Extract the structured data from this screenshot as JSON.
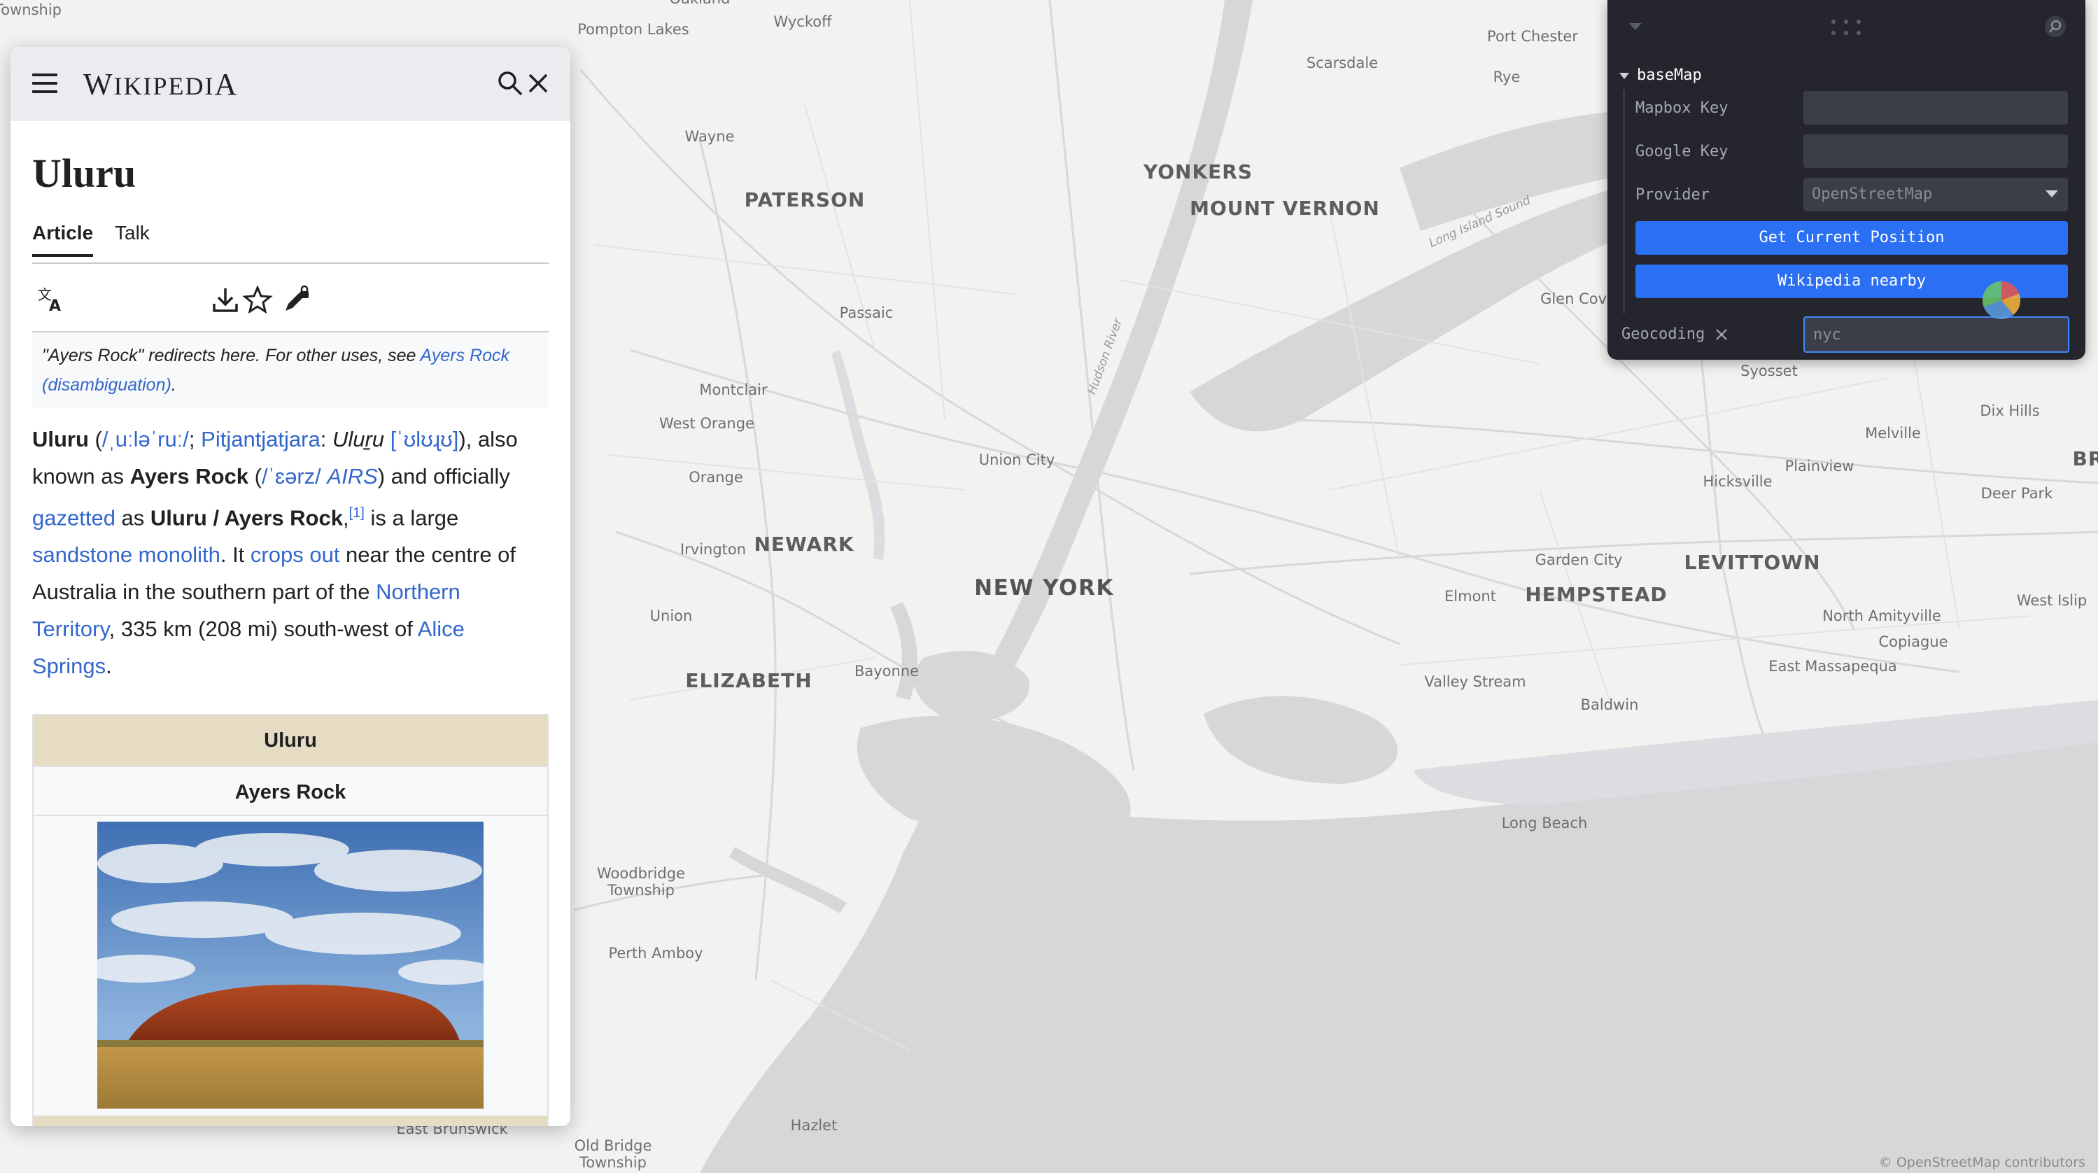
{
  "map": {
    "places": [
      {
        "name": "Township",
        "cls": ""
      },
      {
        "name": "Pompton Lakes",
        "cls": ""
      },
      {
        "name": "Oakland",
        "cls": ""
      },
      {
        "name": "Wyckoff",
        "cls": ""
      },
      {
        "name": "Port Chester",
        "cls": ""
      },
      {
        "name": "Scarsdale",
        "cls": ""
      },
      {
        "name": "Rye",
        "cls": ""
      },
      {
        "name": "Wayne",
        "cls": ""
      },
      {
        "name": "YONKERS",
        "cls": "city"
      },
      {
        "name": "PATERSON",
        "cls": "city"
      },
      {
        "name": "MOUNT VERNON",
        "cls": "city"
      },
      {
        "name": "Long Island Sound",
        "cls": "tilt"
      },
      {
        "name": "Glen Cove",
        "cls": ""
      },
      {
        "name": "Passaic",
        "cls": ""
      },
      {
        "name": "Hudson River",
        "cls": "tilt"
      },
      {
        "name": "Syosset",
        "cls": ""
      },
      {
        "name": "Montclair",
        "cls": ""
      },
      {
        "name": "West Orange",
        "cls": ""
      },
      {
        "name": "Dix Hills",
        "cls": ""
      },
      {
        "name": "Melville",
        "cls": ""
      },
      {
        "name": "Union City",
        "cls": ""
      },
      {
        "name": "Plainview",
        "cls": ""
      },
      {
        "name": "Orange",
        "cls": ""
      },
      {
        "name": "Hicksville",
        "cls": ""
      },
      {
        "name": "Deer Park",
        "cls": ""
      },
      {
        "name": "Irvington",
        "cls": ""
      },
      {
        "name": "NEWARK",
        "cls": "city"
      },
      {
        "name": "Garden City",
        "cls": ""
      },
      {
        "name": "LEVITTOWN",
        "cls": "city"
      },
      {
        "name": "NEW YORK",
        "cls": "big"
      },
      {
        "name": "Elmont",
        "cls": ""
      },
      {
        "name": "HEMPSTEAD",
        "cls": "city"
      },
      {
        "name": "West Islip",
        "cls": ""
      },
      {
        "name": "Union",
        "cls": ""
      },
      {
        "name": "North Amityville",
        "cls": ""
      },
      {
        "name": "Copiague",
        "cls": ""
      },
      {
        "name": "East Massapequa",
        "cls": ""
      },
      {
        "name": "Bayonne",
        "cls": ""
      },
      {
        "name": "ELIZABETH",
        "cls": "city"
      },
      {
        "name": "Valley Stream",
        "cls": ""
      },
      {
        "name": "Baldwin",
        "cls": ""
      },
      {
        "name": "Long Beach",
        "cls": ""
      },
      {
        "name": "Woodbridge\nTownship",
        "cls": ""
      },
      {
        "name": "Perth Amboy",
        "cls": ""
      },
      {
        "name": "East Brunswick",
        "cls": ""
      },
      {
        "name": "Hazlet",
        "cls": ""
      },
      {
        "name": "Old Bridge\nTownship",
        "cls": ""
      },
      {
        "name": "BR",
        "cls": "city"
      }
    ],
    "attribution": "© OpenStreetMap contributors"
  },
  "wiki": {
    "wordmark_first": "W",
    "wordmark_rest": "IKIPEDI",
    "wordmark_last": "A",
    "title": "Uluru",
    "tabs": [
      "Article",
      "Talk"
    ],
    "hatnote": {
      "text": "\"Ayers Rock\" redirects here. For other uses, see ",
      "link": "Ayers Rock (disambiguation)",
      "end": "."
    },
    "lead": {
      "b1": "Uluru",
      "t1": " (",
      "ipa1": "/ˌuːləˈruː/",
      "t2": "; ",
      "lang": "Pitjantjatjara",
      "t3": ": ",
      "i1": "Uluṟu",
      "t4": " ",
      "ipa2": "[ˈʊlʊɻʊ]",
      "t5": "), also known as ",
      "b2": "Ayers Rock",
      "t6": " (",
      "ipa3": "/ˈɛərz/",
      "t7": " ",
      "airs": "AIRS",
      "t8": ") and officially ",
      "l1": "gazetted",
      "t9": " as ",
      "b3": "Uluru / Ayers Rock",
      "t10": ",",
      "sup": "[1]",
      "t11": " is a large ",
      "l2": "sandstone monolith",
      "t12": ". It ",
      "l3": "crops out",
      "t13": " near the centre of Australia in the southern part of the ",
      "l4": "Northern Territory",
      "t14": ", 335 km (208 mi) south-west of ",
      "l5": "Alice Springs",
      "t15": "."
    },
    "infobox": {
      "title": "Uluru",
      "subtitle": "Ayers Rock"
    }
  },
  "gui": {
    "folder": "baseMap",
    "mapbox_label": "Mapbox Key",
    "mapbox_value": "",
    "google_label": "Google Key",
    "google_value": "",
    "provider_label": "Provider",
    "provider_value": "OpenStreetMap",
    "btn_position": "Get Current Position",
    "btn_wiki": "Wikipedia nearby",
    "geo_label": "Geocoding",
    "geo_value": "nyc"
  },
  "colors": {
    "accent": "#2b6ff2",
    "link": "#3366cc",
    "panel": "#25262d"
  }
}
